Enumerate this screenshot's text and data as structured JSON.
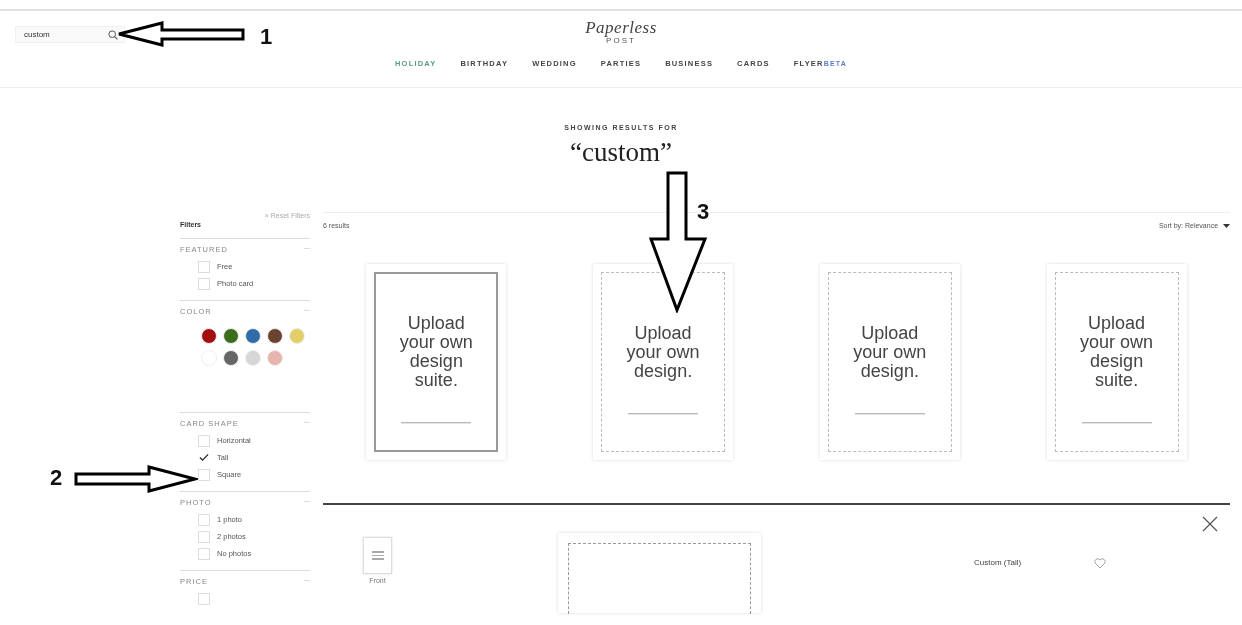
{
  "search": {
    "value": "custom"
  },
  "logo": {
    "name": "Paperless",
    "sub": "POST"
  },
  "nav": [
    {
      "label": "HOLIDAY",
      "selected": true
    },
    {
      "label": "BIRTHDAY",
      "selected": false
    },
    {
      "label": "WEDDING",
      "selected": false
    },
    {
      "label": "PARTIES",
      "selected": false
    },
    {
      "label": "BUSINESS",
      "selected": false
    },
    {
      "label": "CARDS",
      "selected": false
    },
    {
      "label": "FLYER",
      "badge": "BETA",
      "selected": false
    }
  ],
  "heading": {
    "caption": "SHOWING RESULTS FOR",
    "query": "“custom”"
  },
  "filters": {
    "title": "Filters",
    "reset": "× Reset Filters",
    "sections": [
      {
        "kind": "checklist",
        "title": "FEATURED",
        "toggle": "—",
        "options": [
          {
            "label": "Free",
            "checked": false
          },
          {
            "label": "Photo card",
            "checked": false
          }
        ]
      },
      {
        "kind": "swatches",
        "title": "COLOR",
        "toggle": "—",
        "swatches": [
          {
            "color": "#a30f0f"
          },
          {
            "color": "#3b6e1c"
          },
          {
            "color": "#2f6ca8"
          },
          {
            "color": "#6b4330"
          },
          {
            "color": "#e3cf6a"
          },
          {
            "color": "#ffffff"
          },
          {
            "color": "#666666"
          },
          {
            "color": "#d6d6d6"
          },
          {
            "color": "#e8b4ae"
          }
        ]
      },
      {
        "kind": "checklist",
        "title": "CARD SHAPE",
        "toggle": "—",
        "options": [
          {
            "label": "Horizontal",
            "checked": false
          },
          {
            "label": "Tall",
            "checked": true
          },
          {
            "label": "Square",
            "checked": false
          }
        ]
      },
      {
        "kind": "checklist",
        "title": "PHOTO",
        "toggle": "—",
        "options": [
          {
            "label": "1 photo",
            "checked": false
          },
          {
            "label": "2 photos",
            "checked": false
          },
          {
            "label": "No photos",
            "checked": false
          }
        ]
      },
      {
        "kind": "checklist",
        "title": "PRICE",
        "toggle": "—",
        "options": [
          {
            "checked": false
          }
        ]
      }
    ]
  },
  "results": {
    "count": "6 results",
    "sort": "Sort by: Relevance",
    "cards": [
      {
        "kind": "solid",
        "text": "Upload your own design suite."
      },
      {
        "kind": "dashed",
        "text": "Upload your own design."
      },
      {
        "kind": "dashed",
        "text": "Upload your own design."
      },
      {
        "kind": "dashed",
        "text": "Upload your own design suite."
      }
    ]
  },
  "detail": {
    "thumb_label": "Front",
    "title": "Custom (Tall)"
  },
  "annotations": [
    {
      "label": "1"
    },
    {
      "label": "2"
    },
    {
      "label": "3"
    }
  ]
}
